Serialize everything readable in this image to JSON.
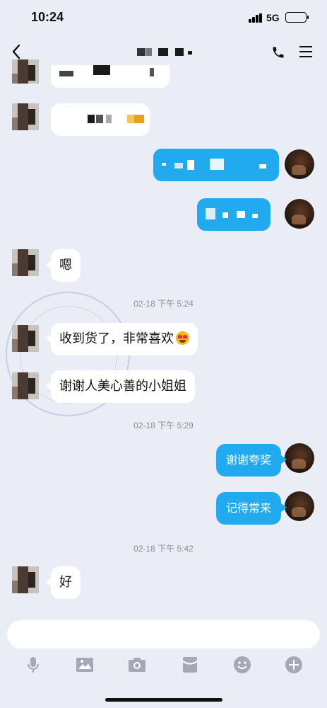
{
  "status_bar": {
    "time": "10:24",
    "network": "5G"
  },
  "nav": {
    "title": ""
  },
  "timestamps": [
    "02-18 下午 5:24",
    "02-18 下午 5:29",
    "02-18 下午 5:42"
  ],
  "messages": {
    "m_en": "嗯",
    "m_received": "收到货了，非常喜欢",
    "m_thanks": "谢谢人美心善的小姐姐",
    "m_reply1": "谢谢夸奖",
    "m_reply2": "记得常来",
    "m_ok": "好"
  },
  "composer": {
    "placeholder": ""
  },
  "colors": {
    "background": "#eaedf5",
    "outgoing_bubble": "#22aaf1",
    "incoming_bubble": "#ffffff"
  },
  "icons": [
    "back-icon",
    "phone-icon",
    "menu-icon",
    "microphone-icon",
    "image-icon",
    "camera-icon",
    "red-packet-icon",
    "emoji-icon",
    "plus-icon",
    "heart-eyes-emoji"
  ]
}
